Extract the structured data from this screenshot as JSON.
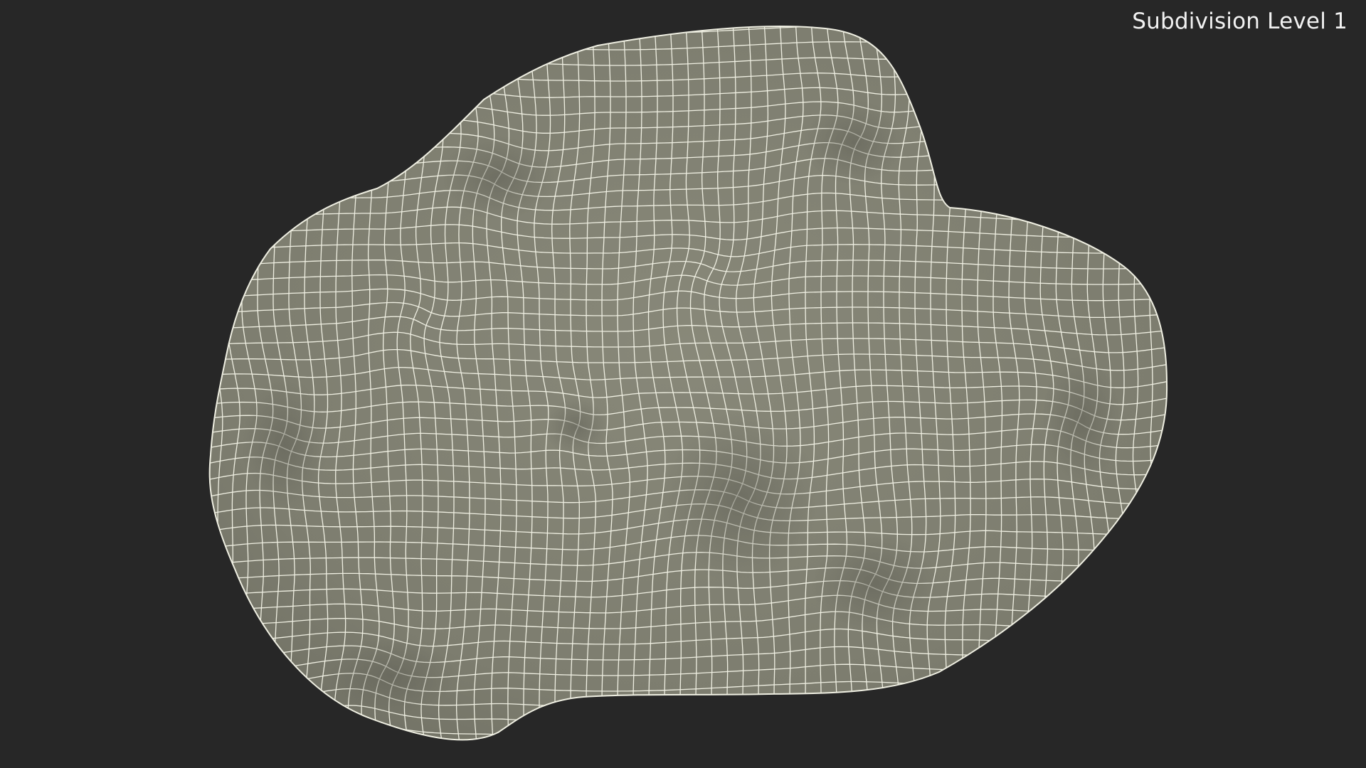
{
  "viewport": {
    "label": "Subdivision Level 1",
    "background_color": "#272727",
    "label_color": "#f2f2f2"
  },
  "model": {
    "description_icon": "subdivided-wireframe-rock",
    "surface_color": "#7f7f71",
    "wire_color": "#efefe2"
  }
}
